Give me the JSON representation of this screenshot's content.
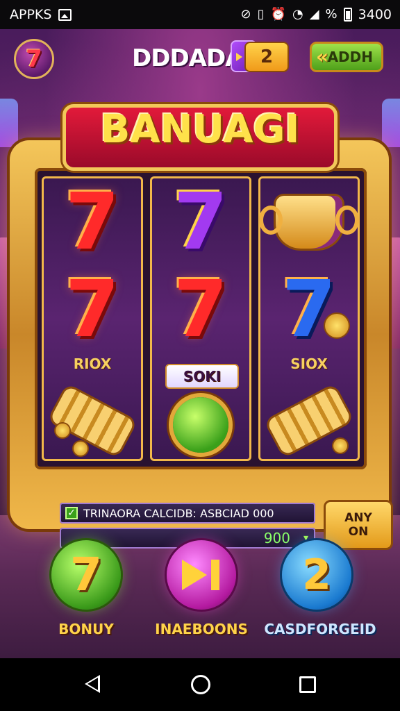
{
  "status_bar": {
    "app_label": "APPKS",
    "time": "3400",
    "icons": [
      "image-icon",
      "data-saver-icon",
      "vibrate-icon",
      "alarm-icon",
      "wifi-icon",
      "signal-icon",
      "no-sim-icon",
      "battery-icon"
    ],
    "no_sim_glyph": "%"
  },
  "header": {
    "brand": "DDDADA",
    "level": "2",
    "back_button": "ADDH"
  },
  "banner": {
    "title": "BANUAGI"
  },
  "reels": [
    {
      "symbols": [
        "red-seven",
        "red-seven"
      ],
      "label": "RIOX",
      "bottom": "golden-horn"
    },
    {
      "symbols": [
        "purple-seven",
        "red-seven"
      ],
      "label": "SOKI",
      "bottom": "green-cup"
    },
    {
      "symbols": [
        "golden-trophy",
        "blue-seven"
      ],
      "label": "SIOX",
      "bottom": "golden-horn"
    }
  ],
  "seven_glyph": "7",
  "info": {
    "line": "TRINAORA CALCIDB: ASBCIAD 000",
    "win_value": "900",
    "spin_button_line1": "ANY",
    "spin_button_line2": "ON"
  },
  "bottom_buttons": [
    {
      "label": "BONUY",
      "icon": "seven-icon",
      "glyph": "7"
    },
    {
      "label": "INAEBOONS",
      "icon": "play-forward-icon"
    },
    {
      "label": "CASDFORGEID",
      "icon": "cards-icon",
      "glyph": "2"
    }
  ],
  "colors": {
    "accent_gold": "#ffd34a",
    "banner_red": "#e21a3a",
    "background_purple": "#4a1c5c",
    "win_green": "#8aff6a"
  }
}
